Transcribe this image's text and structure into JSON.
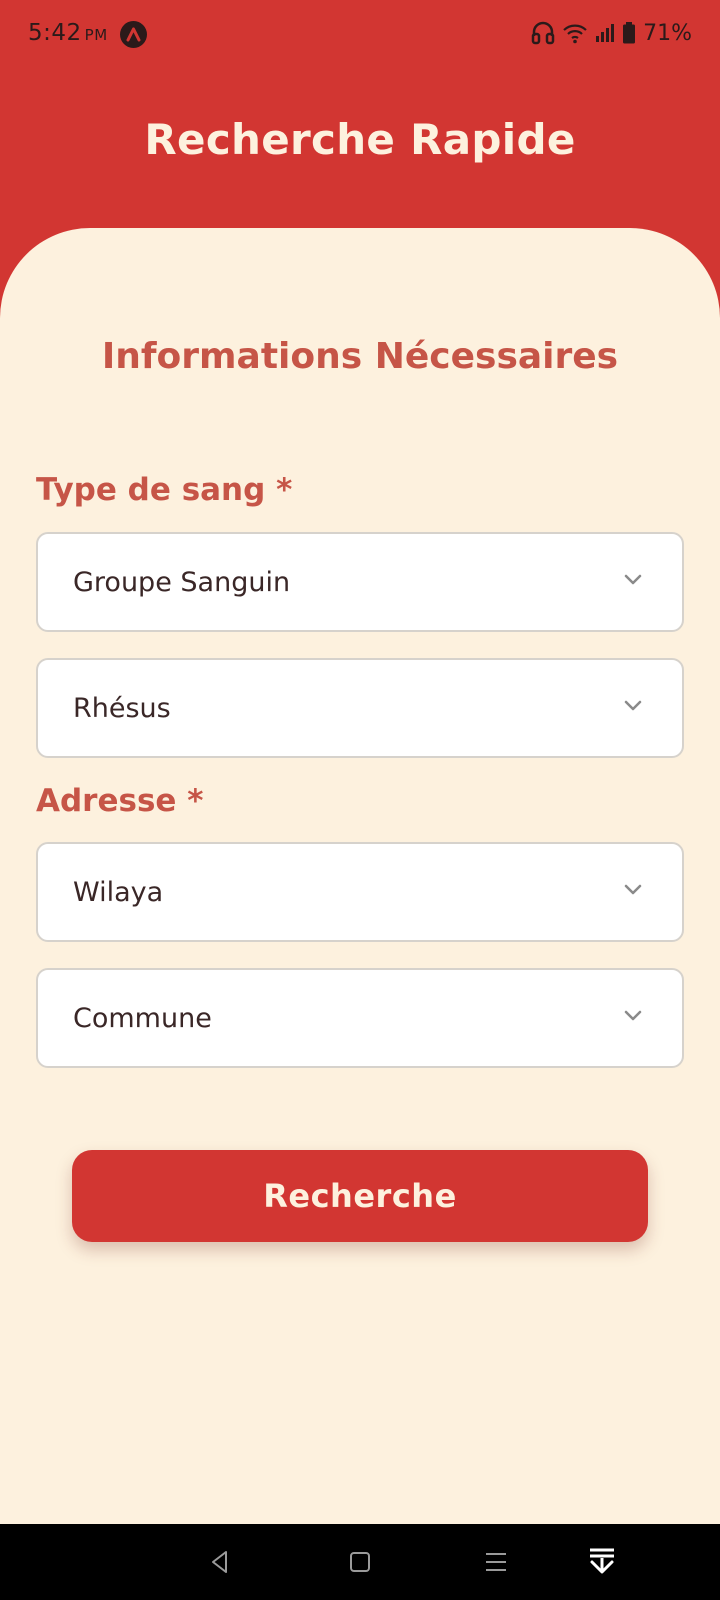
{
  "status_bar": {
    "time": "5:42",
    "ampm": "PM",
    "battery": "71%"
  },
  "header": {
    "title": "Recherche Rapide"
  },
  "form": {
    "section_title": "Informations Nécessaires",
    "blood_type_label": "Type de sang *",
    "blood_group_placeholder": "Groupe Sanguin",
    "rhesus_placeholder": "Rhésus",
    "address_label": "Adresse *",
    "wilaya_placeholder": "Wilaya",
    "commune_placeholder": "Commune",
    "search_button_label": "Recherche"
  },
  "colors": {
    "primary": "#d23632",
    "background": "#fdf1de",
    "label_accent": "#c65547"
  },
  "icons": {
    "dropdown": "chevron-down-icon",
    "nav": [
      "back-icon",
      "home-icon",
      "menu-icon",
      "download-icon"
    ]
  }
}
